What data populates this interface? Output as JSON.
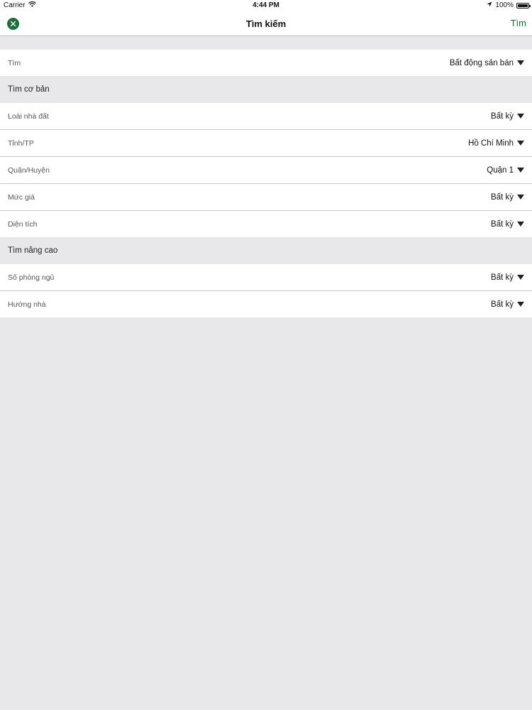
{
  "status_bar": {
    "carrier": "Carrier",
    "time": "4:44 PM",
    "battery": "100%",
    "battery_level": 1.0
  },
  "nav": {
    "title": "Tìm kiếm",
    "search_label": "Tìm"
  },
  "search_type": {
    "label": "Tìm",
    "value": "Bất động sản bán"
  },
  "basic": {
    "header": "Tìm cơ bản",
    "rows": [
      {
        "label": "Loài nhà đất",
        "value": "Bất kỳ"
      },
      {
        "label": "Tỉnh/TP",
        "value": "Hồ Chí Minh"
      },
      {
        "label": "Quận/Huyện",
        "value": "Quận 1"
      },
      {
        "label": "Mức giá",
        "value": "Bất kỳ"
      },
      {
        "label": "Diện tích",
        "value": "Bất kỳ"
      }
    ]
  },
  "advanced": {
    "header": "Tìm nâng cao",
    "rows": [
      {
        "label": "Số phòng ngủ",
        "value": "Bất kỳ"
      },
      {
        "label": "Hướng nhà",
        "value": "Bất kỳ"
      }
    ]
  },
  "colors": {
    "accent": "#1d6f3a",
    "background": "#e8e7ea",
    "row_background": "#ffffff",
    "divider": "#c8c7cc"
  }
}
